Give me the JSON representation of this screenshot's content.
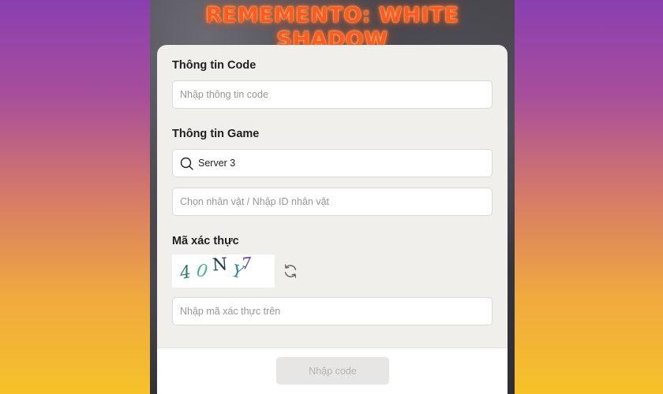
{
  "header": {
    "game_title": "REMEMENTO: WHITE SHADOW"
  },
  "code_section": {
    "label": "Thông tin Code",
    "placeholder": "Nhập thông tin code"
  },
  "game_section": {
    "label": "Thông tin Game",
    "server_value": "Server 3",
    "server_icon": "search-icon",
    "character_placeholder": "Chọn nhân vật / Nhập ID nhân vật"
  },
  "captcha_section": {
    "label": "Mã xác thực",
    "captcha_chars": [
      "4",
      "0",
      "N",
      "Y",
      "7"
    ],
    "captcha_colors": [
      "#2e7d6b",
      "#49b48f",
      "#1e3a4a",
      "#3a8fa0",
      "#6a3bb0"
    ],
    "refresh_icon": "refresh-icon",
    "placeholder": "Nhập mã xác thực trên"
  },
  "footer": {
    "submit_label": "Nhập code"
  },
  "colors": {
    "title": "#ff5a1f",
    "panel": "#f1efec",
    "button_disabled_bg": "#e7e6e4",
    "button_disabled_text": "#b5b3b0"
  }
}
